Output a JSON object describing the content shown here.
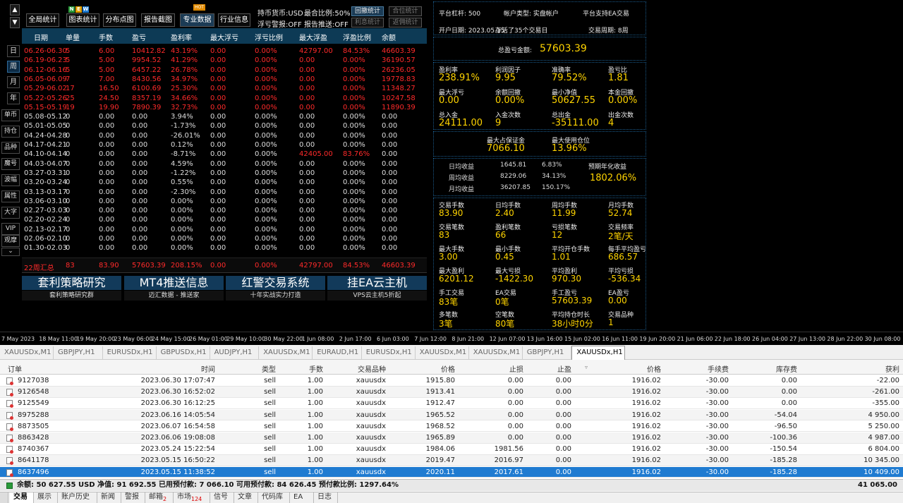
{
  "nav": {
    "up": "▲",
    "down": "▼",
    "period_buttons": [
      "日",
      "周",
      "月",
      "年"
    ],
    "side_buttons": [
      "单币",
      "持仓",
      "品种",
      "魔号",
      "波幅",
      "属性",
      "大字",
      "VIP",
      "观摩"
    ],
    "more": "⌄"
  },
  "toolbar": {
    "badges": [
      "N",
      "E",
      "W"
    ],
    "hot": "HOT",
    "buttons": [
      "全局统计",
      "图表统计",
      "分布点图",
      "报告截图",
      "专业数据",
      "行业信息"
    ],
    "opt1": "持币货币:USD",
    "opt2": "最合比例:50%",
    "opt3": "浮亏警报:OFF",
    "opt4": "报告推送:OFF",
    "mini": [
      "回撤统计",
      "合位统计",
      "利息统计",
      "返佣统计"
    ]
  },
  "table": {
    "headers": [
      "日期",
      "单量",
      "手数",
      "盈亏",
      "盈利率",
      "最大浮亏",
      "浮亏比例",
      "最大浮盈",
      "浮盈比例",
      "余额"
    ],
    "rows": [
      [
        "06.26-06.30",
        "5",
        "6.00",
        "10412.82",
        "43.19%",
        "0.00",
        "0.00%",
        "42797.00",
        "84.53%",
        "46603.39"
      ],
      [
        "06.19-06.23",
        "5",
        "5.00",
        "9954.52",
        "41.29%",
        "0.00",
        "0.00%",
        "0.00",
        "0.00%",
        "36190.57"
      ],
      [
        "06.12-06.16",
        "5",
        "5.00",
        "6457.22",
        "26.78%",
        "0.00",
        "0.00%",
        "0.00",
        "0.00%",
        "26236.05"
      ],
      [
        "06.05-06.09",
        "7",
        "7.00",
        "8430.56",
        "34.97%",
        "0.00",
        "0.00%",
        "0.00",
        "0.00%",
        "19778.83"
      ],
      [
        "05.29-06.02",
        "17",
        "16.50",
        "6100.69",
        "25.30%",
        "0.00",
        "0.00%",
        "0.00",
        "0.00%",
        "11348.27"
      ],
      [
        "05.22-05.26",
        "25",
        "24.50",
        "8357.19",
        "34.66%",
        "0.00",
        "0.00%",
        "0.00",
        "0.00%",
        "10247.58"
      ],
      [
        "05.15-05.19",
        "19",
        "19.90",
        "7890.39",
        "32.73%",
        "0.00",
        "0.00%",
        "0.00",
        "0.00%",
        "11890.39"
      ],
      [
        "05.08-05.12",
        "0",
        "0.00",
        "0.00",
        "3.94%",
        "0.00",
        "0.00%",
        "0.00",
        "0.00%",
        "0.00"
      ],
      [
        "05.01-05.05",
        "0",
        "0.00",
        "0.00",
        "-1.73%",
        "0.00",
        "0.00%",
        "0.00",
        "0.00%",
        "0.00"
      ],
      [
        "04.24-04.28",
        "0",
        "0.00",
        "0.00",
        "-26.01%",
        "0.00",
        "0.00%",
        "0.00",
        "0.00%",
        "0.00"
      ],
      [
        "04.17-04.21",
        "0",
        "0.00",
        "0.00",
        "0.12%",
        "0.00",
        "0.00%",
        "0.00",
        "0.00%",
        "0.00"
      ],
      [
        "04.10-04.14",
        "0",
        "0.00",
        "0.00",
        "-8.71%",
        "0.00",
        "0.00%",
        "42405.00",
        "83.76%",
        "0.00"
      ],
      [
        "04.03-04.07",
        "0",
        "0.00",
        "0.00",
        "4.59%",
        "0.00",
        "0.00%",
        "0.00",
        "0.00%",
        "0.00"
      ],
      [
        "03.27-03.31",
        "0",
        "0.00",
        "0.00",
        "-1.22%",
        "0.00",
        "0.00%",
        "0.00",
        "0.00%",
        "0.00"
      ],
      [
        "03.20-03.24",
        "0",
        "0.00",
        "0.00",
        "0.55%",
        "0.00",
        "0.00%",
        "0.00",
        "0.00%",
        "0.00"
      ],
      [
        "03.13-03.17",
        "0",
        "0.00",
        "0.00",
        "-2.30%",
        "0.00",
        "0.00%",
        "0.00",
        "0.00%",
        "0.00"
      ],
      [
        "03.06-03.10",
        "0",
        "0.00",
        "0.00",
        "0.00%",
        "0.00",
        "0.00%",
        "0.00",
        "0.00%",
        "0.00"
      ],
      [
        "02.27-03.03",
        "0",
        "0.00",
        "0.00",
        "0.00%",
        "0.00",
        "0.00%",
        "0.00",
        "0.00%",
        "0.00"
      ],
      [
        "02.20-02.24",
        "0",
        "0.00",
        "0.00",
        "0.00%",
        "0.00",
        "0.00%",
        "0.00",
        "0.00%",
        "0.00"
      ],
      [
        "02.13-02.17",
        "0",
        "0.00",
        "0.00",
        "0.00%",
        "0.00",
        "0.00%",
        "0.00",
        "0.00%",
        "0.00"
      ],
      [
        "02.06-02.10",
        "0",
        "0.00",
        "0.00",
        "0.00%",
        "0.00",
        "0.00%",
        "0.00",
        "0.00%",
        "0.00"
      ],
      [
        "01.30-02.03",
        "0",
        "0.00",
        "0.00",
        "0.00%",
        "0.00",
        "0.00%",
        "0.00",
        "0.00%",
        "0.00"
      ]
    ],
    "red_rows": 7,
    "red_cells": [
      [
        11,
        7
      ],
      [
        11,
        8
      ]
    ],
    "summary": [
      "22周汇总",
      "83",
      "83.90",
      "57603.39",
      "208.15%",
      "0.00",
      "0.00%",
      "42797.00",
      "84.53%",
      "46603.39"
    ]
  },
  "ads": [
    {
      "title": "套利策略研究",
      "sub": "套利策略研究群"
    },
    {
      "title": "MT4推送信息",
      "sub": "迈汇数据 - 推送家"
    },
    {
      "title": "红警交易系统",
      "sub": "十年实战实力打造"
    },
    {
      "title": "挂EA云主机",
      "sub": "VPS云主机5折起"
    }
  ],
  "right": {
    "info1": [
      "平台杠杆: 500",
      "帐户类型: 实盘帐户",
      "平台支持EA交易"
    ],
    "info2": [
      "开户日期: 2023.05.15",
      "存活了35个交易日",
      "交易周期: 8周"
    ],
    "total_label": "总盈亏金额:",
    "total_value": "57603.39",
    "g1": [
      {
        "l": "盈利率",
        "v": "238.91%"
      },
      {
        "l": "利润因子",
        "v": "9.95"
      },
      {
        "l": "准确率",
        "v": "79.52%"
      },
      {
        "l": "盈亏比",
        "v": "1.81"
      },
      {
        "l": "最大浮亏",
        "v": "0.00"
      },
      {
        "l": "余额回撤",
        "v": "0.00%"
      },
      {
        "l": "最小净值",
        "v": "50627.55"
      },
      {
        "l": "本金回撤",
        "v": "0.00%"
      },
      {
        "l": "总入金",
        "v": "24111.00"
      },
      {
        "l": "入金次数",
        "v": "9"
      },
      {
        "l": "总出金",
        "v": "-35111.00"
      },
      {
        "l": "出金次数",
        "v": "4"
      }
    ],
    "margin": [
      {
        "l": "最大占保证金",
        "v": "7066.10"
      },
      {
        "l": "最大使用仓位",
        "v": "13.96%"
      }
    ],
    "income": [
      {
        "l": "日均收益",
        "a": "1645.81",
        "b": "6.83%"
      },
      {
        "l": "周均收益",
        "a": "8229.06",
        "b": "34.13%"
      },
      {
        "l": "月均收益",
        "a": "36207.85",
        "b": "150.17%"
      }
    ],
    "annual_label": "预期年化收益",
    "annual_value": "1802.06%",
    "g2": [
      {
        "l": "交易手数",
        "v": "83.90"
      },
      {
        "l": "日均手数",
        "v": "2.40"
      },
      {
        "l": "周均手数",
        "v": "11.99"
      },
      {
        "l": "月均手数",
        "v": "52.74"
      },
      {
        "l": "交易笔数",
        "v": "83"
      },
      {
        "l": "盈利笔数",
        "v": "66"
      },
      {
        "l": "亏损笔数",
        "v": "12"
      },
      {
        "l": "交易频率",
        "v": "2笔/天"
      },
      {
        "l": "最大手数",
        "v": "3.00"
      },
      {
        "l": "最小手数",
        "v": "0.45"
      },
      {
        "l": "平均开仓手数",
        "v": "1.01"
      },
      {
        "l": "每手平均盈亏",
        "v": "686.57"
      },
      {
        "l": "最大盈利",
        "v": "6201.12"
      },
      {
        "l": "最大亏损",
        "v": "-1422.30"
      },
      {
        "l": "平均盈利",
        "v": "970.30"
      },
      {
        "l": "平均亏损",
        "v": "-536.34"
      },
      {
        "l": "手工交易",
        "v": "83笔"
      },
      {
        "l": "EA交易",
        "v": "0笔"
      },
      {
        "l": "手工盈亏",
        "v": "57603.39"
      },
      {
        "l": "EA盈亏",
        "v": "0.00"
      },
      {
        "l": "多笔数",
        "v": "3笔"
      },
      {
        "l": "空笔数",
        "v": "80笔"
      },
      {
        "l": "平均持仓时长",
        "v": "38小时0分"
      },
      {
        "l": "交易品种",
        "v": "1"
      }
    ]
  },
  "axis": [
    "7 May 2023",
    "18 May 11:00",
    "19 May 20:00",
    "23 May 06:00",
    "24 May 15:00",
    "26 May 01:00",
    "29 May 10:00",
    "30 May 22:00",
    "1 Jun 08:00",
    "2 Jun 17:00",
    "6 Jun 03:00",
    "7 Jun 12:00",
    "8 Jun 21:00",
    "12 Jun 07:00",
    "13 Jun 16:00",
    "15 Jun 02:00",
    "16 Jun 11:00",
    "19 Jun 20:00",
    "21 Jun 06:00",
    "22 Jun 18:00",
    "26 Jun 04:00",
    "27 Jun 13:00",
    "28 Jun 22:00",
    "30 Jun 08:00"
  ],
  "chart_tabs": [
    "XAUUSDx,M1",
    "GBPJPY,H1",
    "EURUSDx,H1",
    "GBPUSDx,H1",
    "AUDJPY,H1",
    "XAUUSDx,M1",
    "EURAUD,H1",
    "EURUSDx,H1",
    "XAUUSDx,M1",
    "XAUUSDx,M1",
    "GBPJPY,H1",
    "XAUUSDx,H1"
  ],
  "terminal": {
    "headers": [
      "订单",
      "时间",
      "类型",
      "手数",
      "交易品种",
      "价格",
      "止损",
      "止盈",
      "价格",
      "手续费",
      "库存费",
      "获利"
    ],
    "rows": [
      [
        "9127038",
        "2023.06.30 17:07:47",
        "sell",
        "1.00",
        "xauusdx",
        "1915.80",
        "0.00",
        "0.00",
        "1916.02",
        "-30.00",
        "0.00",
        "-22.00"
      ],
      [
        "9126548",
        "2023.06.30 16:52:02",
        "sell",
        "1.00",
        "xauusdx",
        "1913.41",
        "0.00",
        "0.00",
        "1916.02",
        "-30.00",
        "0.00",
        "-261.00"
      ],
      [
        "9125549",
        "2023.06.30 16:12:25",
        "sell",
        "1.00",
        "xauusdx",
        "1912.47",
        "0.00",
        "0.00",
        "1916.02",
        "-30.00",
        "0.00",
        "-355.00"
      ],
      [
        "8975288",
        "2023.06.16 14:05:54",
        "sell",
        "1.00",
        "xauusdx",
        "1965.52",
        "0.00",
        "0.00",
        "1916.02",
        "-30.00",
        "-54.04",
        "4 950.00"
      ],
      [
        "8873505",
        "2023.06.07 16:54:58",
        "sell",
        "1.00",
        "xauusdx",
        "1968.52",
        "0.00",
        "0.00",
        "1916.02",
        "-30.00",
        "-96.50",
        "5 250.00"
      ],
      [
        "8863428",
        "2023.06.06 19:08:08",
        "sell",
        "1.00",
        "xauusdx",
        "1965.89",
        "0.00",
        "0.00",
        "1916.02",
        "-30.00",
        "-100.36",
        "4 987.00"
      ],
      [
        "8740367",
        "2023.05.24 15:22:54",
        "sell",
        "1.00",
        "xauusdx",
        "1984.06",
        "1981.56",
        "0.00",
        "1916.02",
        "-30.00",
        "-150.54",
        "6 804.00"
      ],
      [
        "8641178",
        "2023.05.15 16:50:22",
        "sell",
        "1.00",
        "xauusdx",
        "2019.47",
        "2016.97",
        "0.00",
        "1916.02",
        "-30.00",
        "-185.28",
        "10 345.00"
      ],
      [
        "8637496",
        "2023.05.15 11:38:52",
        "sell",
        "1.00",
        "xauusdx",
        "2020.11",
        "2017.61",
        "0.00",
        "1916.02",
        "-30.00",
        "-185.28",
        "10 409.00"
      ]
    ],
    "balance_line": "余额: 50 627.55 USD  净值: 91 692.55  已用预付款: 7 066.10  可用预付款: 84 626.45  预付款比例: 1297.64%",
    "balance_total": "41 065.00"
  },
  "bottom_tabs": [
    {
      "l": "交易",
      "n": ""
    },
    {
      "l": "展示",
      "n": ""
    },
    {
      "l": "账户历史",
      "n": ""
    },
    {
      "l": "新闻",
      "n": ""
    },
    {
      "l": "警报",
      "n": ""
    },
    {
      "l": "邮箱",
      "n": "2"
    },
    {
      "l": "市场",
      "n": "124"
    },
    {
      "l": "信号",
      "n": ""
    },
    {
      "l": "文章",
      "n": ""
    },
    {
      "l": "代码库",
      "n": ""
    },
    {
      "l": "EA",
      "n": ""
    },
    {
      "l": "日志",
      "n": ""
    }
  ],
  "colors": {
    "red": "#ff2a2a",
    "yellow": "#ffd400",
    "header_blue": "#0d3a55",
    "selected": "#1f7bd1"
  }
}
